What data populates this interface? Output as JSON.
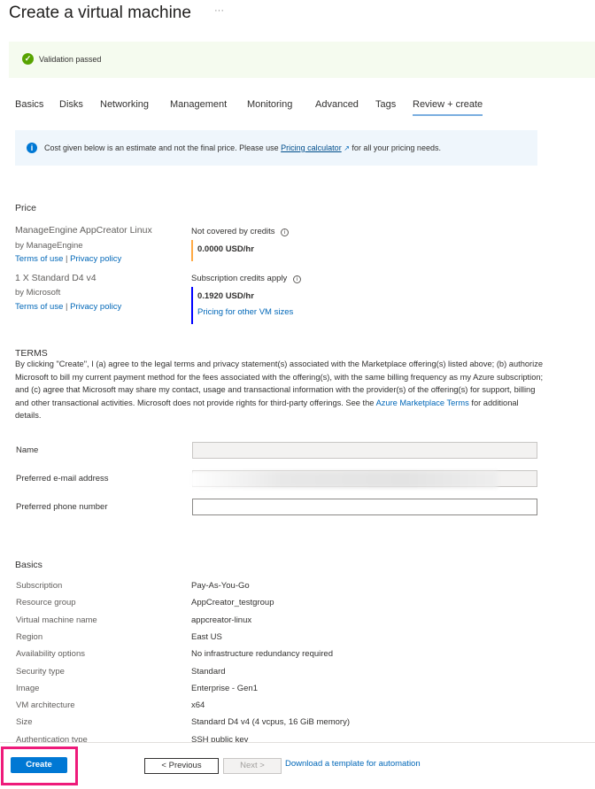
{
  "header": {
    "title": "Create a virtual machine",
    "more": "···"
  },
  "validation": {
    "text": "Validation passed"
  },
  "tabs": [
    "Basics",
    "Disks",
    "Networking",
    "Management",
    "Monitoring",
    "Advanced",
    "Tags",
    "Review + create"
  ],
  "info": {
    "pre": "Cost given below is an estimate and not the final price. Please use ",
    "link": "Pricing calculator",
    "ext": "↗",
    "post": " for all your pricing needs."
  },
  "price": {
    "heading": "Price",
    "items": [
      {
        "name": "ManageEngine AppCreator Linux",
        "by": "by ManageEngine",
        "terms": "Terms of use",
        "sep": "|",
        "privacy": "Privacy policy",
        "status": "Not covered by credits",
        "amount": "0.0000 USD/hr",
        "bar_color": "#ffaa44"
      },
      {
        "name": "1 X Standard D4 v4",
        "by": "by Microsoft",
        "terms": "Terms of use",
        "sep": "|",
        "privacy": "Privacy policy",
        "status": "Subscription credits apply",
        "amount": "0.1920 USD/hr",
        "bar_color": "#0000ff",
        "extra_link": "Pricing for other VM sizes"
      }
    ]
  },
  "terms": {
    "heading": "TERMS",
    "text": "By clicking \"Create\", I (a) agree to the legal terms and privacy statement(s) associated with the Marketplace offering(s) listed above; (b) authorize Microsoft to bill my current payment method for the fees associated with the offering(s), with the same billing frequency as my Azure subscription; and (c) agree that Microsoft may share my contact, usage and transactional information with the provider(s) of the offering(s) for support, billing and other transactional activities. Microsoft does not provide rights for third-party offerings. See the ",
    "link": "Azure Marketplace Terms",
    "post": " for additional details."
  },
  "contact": {
    "name_label": "Name",
    "email_label": "Preferred e-mail address",
    "phone_label": "Preferred phone number",
    "name_value": "",
    "email_value": "",
    "phone_value": ""
  },
  "basics": {
    "heading": "Basics",
    "rows": [
      {
        "k": "Subscription",
        "v": "Pay-As-You-Go"
      },
      {
        "k": "Resource group",
        "v": "AppCreator_testgroup"
      },
      {
        "k": "Virtual machine name",
        "v": "appcreator-linux"
      },
      {
        "k": "Region",
        "v": "East US"
      },
      {
        "k": "Availability options",
        "v": "No infrastructure redundancy required"
      },
      {
        "k": "Security type",
        "v": "Standard"
      },
      {
        "k": "Image",
        "v": "Enterprise - Gen1"
      },
      {
        "k": "VM architecture",
        "v": "x64"
      },
      {
        "k": "Size",
        "v": "Standard D4 v4 (4 vcpus, 16 GiB memory)"
      },
      {
        "k": "Authentication type",
        "v": "SSH public key"
      }
    ]
  },
  "footer": {
    "create": "Create",
    "previous": "< Previous",
    "next": "Next >",
    "download": "Download a template for automation"
  },
  "colors": {
    "accent": "#0078d4",
    "highlight": "#ee1a7a",
    "success": "#57a300"
  }
}
